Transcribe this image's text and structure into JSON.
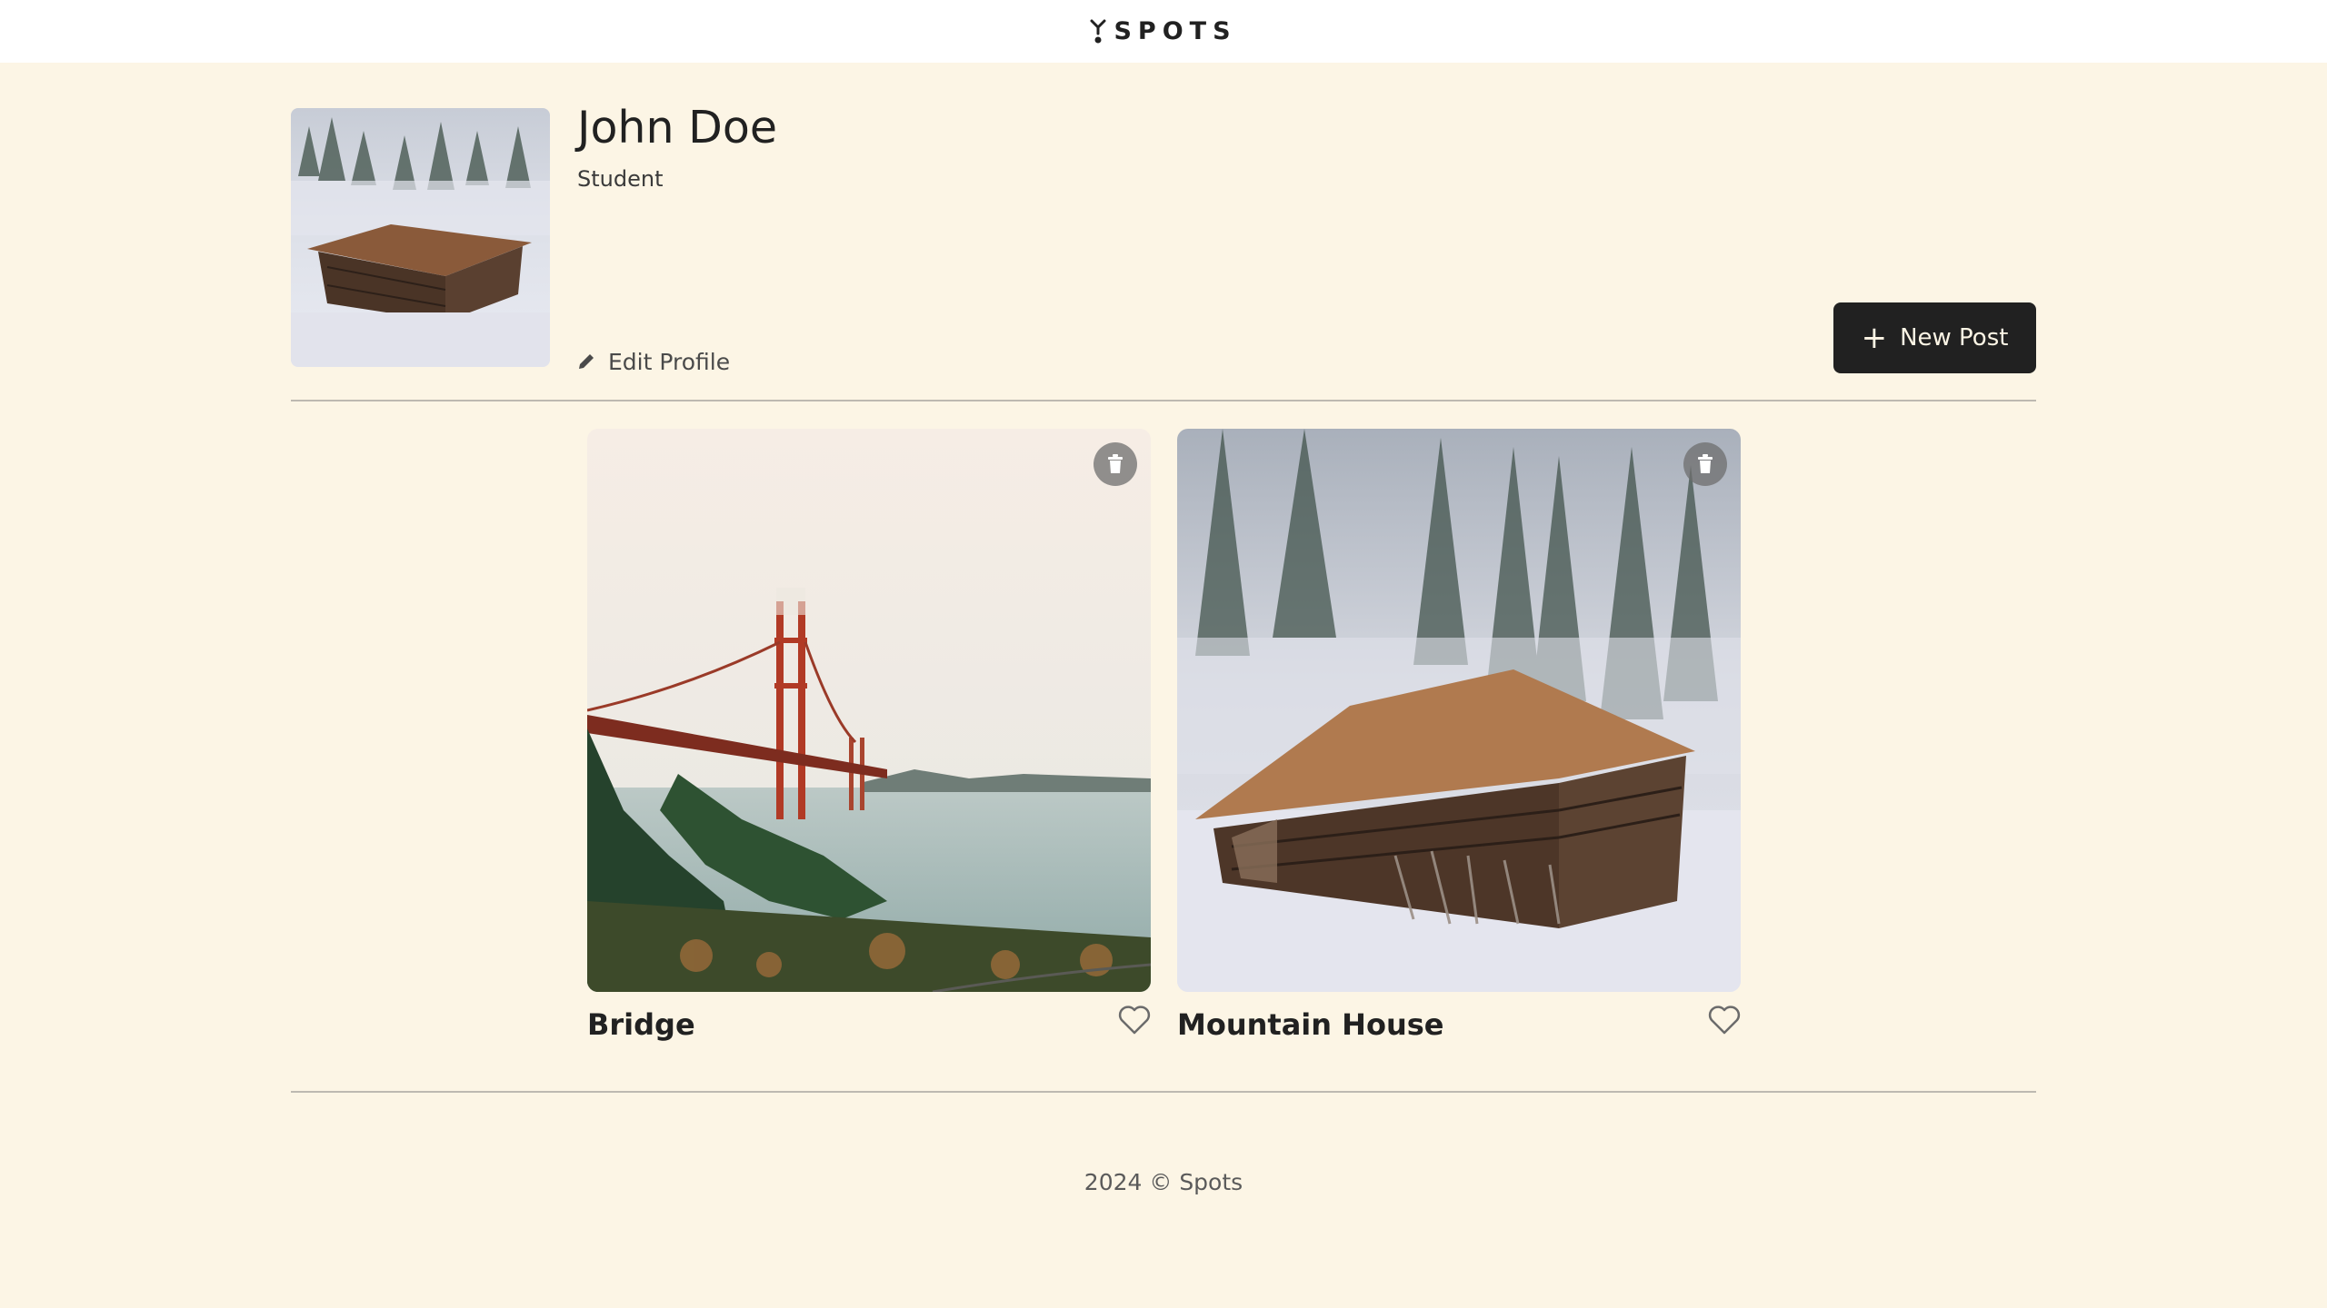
{
  "header": {
    "logo_text": "SPOTS",
    "logo_icon": "spots-logo-icon"
  },
  "profile": {
    "name": "John Doe",
    "description": "Student",
    "avatar_alt": "Profile avatar",
    "edit_label": "Edit Profile",
    "edit_icon": "pencil-icon",
    "new_post_label": "New Post",
    "new_post_icon": "plus-icon"
  },
  "cards": [
    {
      "title": "Bridge",
      "like_icon": "heart-outline-icon",
      "delete_icon": "trash-icon"
    },
    {
      "title": "Mountain House",
      "like_icon": "heart-outline-icon",
      "delete_icon": "trash-icon"
    }
  ],
  "footer": {
    "text": "2024 © Spots"
  },
  "colors": {
    "page_background": "#fcf5e5",
    "header_background": "#ffffff",
    "button_dark": "#212121",
    "divider": "#bdb9b1"
  }
}
